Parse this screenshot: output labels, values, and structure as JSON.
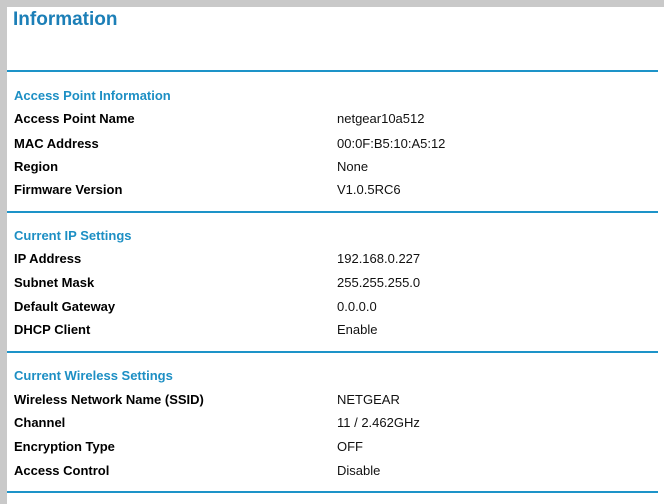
{
  "page": {
    "title": "Information"
  },
  "sections": {
    "access_point": {
      "heading": "Access Point Information",
      "rows": [
        {
          "label": "Access Point Name",
          "value": "netgear10a512"
        },
        {
          "label": "MAC Address",
          "value": "00:0F:B5:10:A5:12"
        },
        {
          "label": "Region",
          "value": "None"
        },
        {
          "label": "Firmware Version",
          "value": "V1.0.5RC6"
        }
      ]
    },
    "ip_settings": {
      "heading": "Current IP Settings",
      "rows": [
        {
          "label": "IP Address",
          "value": "192.168.0.227"
        },
        {
          "label": "Subnet Mask",
          "value": "255.255.255.0"
        },
        {
          "label": "Default Gateway",
          "value": "0.0.0.0"
        },
        {
          "label": "DHCP Client",
          "value": "Enable"
        }
      ]
    },
    "wireless_settings": {
      "heading": "Current Wireless Settings",
      "rows": [
        {
          "label": "Wireless Network Name (SSID)",
          "value": "NETGEAR"
        },
        {
          "label": "Channel",
          "value": "11 / 2.462GHz"
        },
        {
          "label": "Encryption Type",
          "value": "OFF"
        },
        {
          "label": "Access Control",
          "value": "Disable"
        }
      ]
    }
  },
  "colors": {
    "accent": "#1d8fc4",
    "border": "#c9c9c9"
  }
}
